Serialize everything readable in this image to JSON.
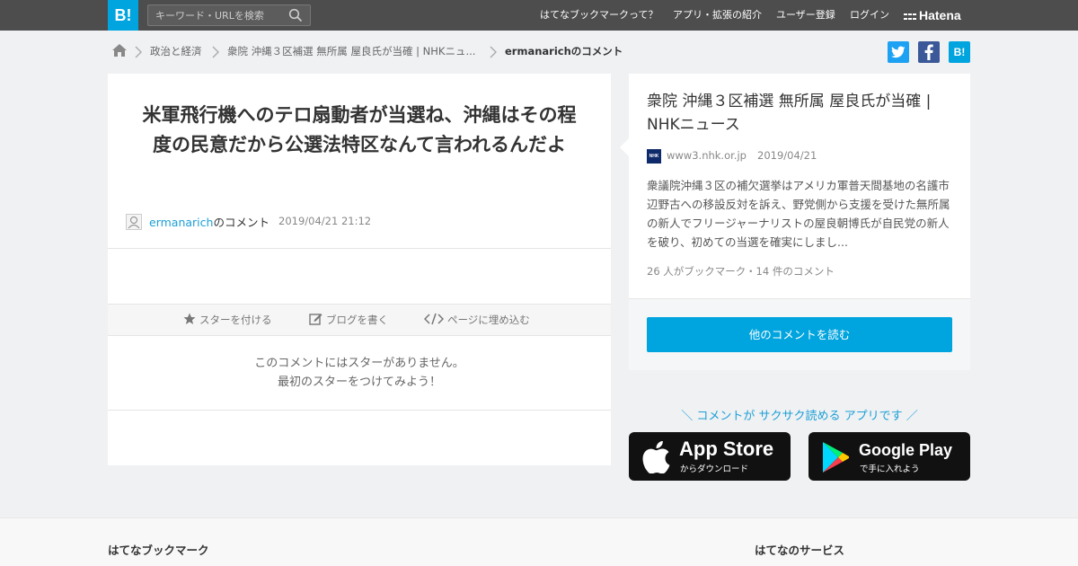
{
  "header": {
    "logo": "B!",
    "search_placeholder": "キーワード・URLを検索",
    "nav": [
      "はてなブックマークって？",
      "アプリ・拡張の紹介",
      "ユーザー登録",
      "ログイン"
    ],
    "brand": "Hatena"
  },
  "breadcrumb": {
    "items": [
      "政治と経済",
      "衆院 沖縄３区補選 無所属 屋良氏が当確 | NHKニュ...",
      "ermanarichのコメント"
    ]
  },
  "share": {
    "twitter": "t",
    "facebook": "f",
    "hatena": "B!"
  },
  "comment": {
    "text": "米軍飛行機へのテロ扇動者が当選ね、沖縄はその程度の民意だから公選法特区なんて言われるんだよ",
    "user": "ermanarich",
    "user_suffix": "のコメント",
    "datetime": "2019/04/21 21:12",
    "actions": {
      "star": "スターを付ける",
      "blog": "ブログを書く",
      "embed": "ページに埋め込む"
    },
    "no_star_line1": "このコメントにはスターがありません。",
    "no_star_line2": "最初のスターをつけてみよう！"
  },
  "entry": {
    "title": "衆院 沖縄３区補選 無所属 屋良氏が当確 | NHKニュース",
    "favicon_text": "NHK",
    "domain": "www3.nhk.or.jp",
    "date": "2019/04/21",
    "summary": "衆議院沖縄３区の補欠選挙はアメリカ軍普天間基地の名護市辺野古への移設反対を訴え、野党側から支援を受けた無所属の新人でフリージャーナリストの屋良朝博氏が自民党の新人を破り、初めての当選を確実にしまし...",
    "counts": "26 人がブックマーク・14 件のコメント",
    "read_more": "他のコメントを読む"
  },
  "promo": {
    "tagline": "＼ コメントが サクサク読める アプリです ／",
    "appstore_big": "App Store",
    "appstore_small": "からダウンロード",
    "googleplay_big": "Google Play",
    "googleplay_small": "で手に入れよう"
  },
  "footer": {
    "col1": "はてなブックマーク",
    "col2": "はてなのサービス"
  },
  "colors": {
    "header_bg": "#4d4d4d",
    "accent": "#00a4de",
    "link": "#1c9fd6",
    "twitter": "#1da1f2",
    "facebook": "#3b5998"
  }
}
